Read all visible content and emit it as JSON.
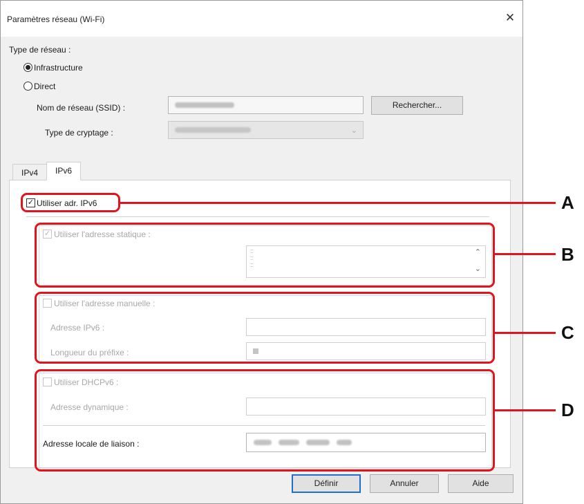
{
  "window": {
    "title": "Paramètres réseau (Wi-Fi)",
    "close": "✕"
  },
  "network_type": {
    "label": "Type de réseau :",
    "options": [
      {
        "label": "Infrastructure",
        "selected": true
      },
      {
        "label": "Direct",
        "selected": false
      }
    ]
  },
  "ssid": {
    "label": "Nom de réseau (SSID) :",
    "search_button": "Rechercher..."
  },
  "encryption": {
    "label": "Type de cryptage :"
  },
  "tabs": [
    {
      "label": "IPv4"
    },
    {
      "label": "IPv6",
      "active": true
    }
  ],
  "ipv6": {
    "use_ipv6_label": "Utiliser adr. IPv6",
    "use_ipv6_checked": true,
    "static": {
      "label": "Utiliser l'adresse statique :",
      "checked": true
    },
    "manual": {
      "label": "Utiliser l'adresse manuelle :",
      "checked": false,
      "address_label": "Adresse IPv6 :",
      "prefix_label": "Longueur du préfixe :"
    },
    "dhcp": {
      "label": "Utiliser DHCPv6 :",
      "checked": false,
      "dynamic_label": "Adresse dynamique :"
    },
    "link_local_label": "Adresse locale de liaison :"
  },
  "buttons": {
    "ok": "Définir",
    "cancel": "Annuler",
    "help": "Aide"
  },
  "callouts": {
    "a": "A",
    "b": "B",
    "c": "C",
    "d": "D"
  },
  "colors": {
    "callout_red": "#e0141e",
    "default_button_border": "#1f6fd1"
  }
}
